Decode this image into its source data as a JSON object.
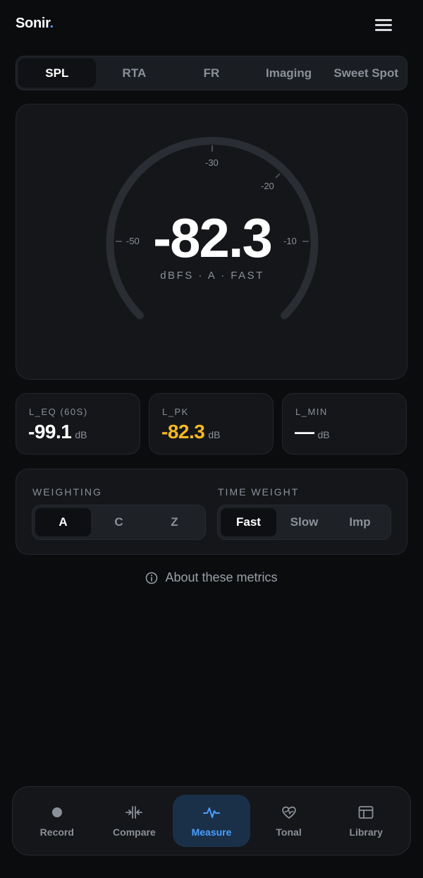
{
  "app": {
    "name": "Sonir",
    "name_dot": "."
  },
  "tabs": [
    {
      "label": "SPL",
      "active": true
    },
    {
      "label": "RTA",
      "active": false
    },
    {
      "label": "FR",
      "active": false
    },
    {
      "label": "Imaging",
      "active": false
    },
    {
      "label": "Sweet Spot",
      "active": false
    }
  ],
  "gauge": {
    "value": "-82.3",
    "unit_line": "dBFS · A · FAST",
    "tick_labels": {
      "t50": "-50",
      "t30": "-30",
      "t20": "-20",
      "t10": "-10"
    }
  },
  "stats": [
    {
      "label": "L_EQ (60S)",
      "value": "-99.1",
      "unit": "dB"
    },
    {
      "label": "L_PK",
      "value": "-82.3",
      "unit": "dB"
    },
    {
      "label": "L_MIN",
      "value": "—",
      "unit": "dB"
    }
  ],
  "controls": {
    "weighting": {
      "label": "WEIGHTING",
      "options": [
        "A",
        "C",
        "Z"
      ],
      "selected": "A"
    },
    "time_weight": {
      "label": "TIME WEIGHT",
      "options": [
        "Fast",
        "Slow",
        "Imp"
      ],
      "selected": "Fast"
    }
  },
  "about_link": "About these metrics",
  "nav": [
    {
      "label": "Record",
      "icon": "record-icon",
      "active": false
    },
    {
      "label": "Compare",
      "icon": "compare-icon",
      "active": false
    },
    {
      "label": "Measure",
      "icon": "pulse-icon",
      "active": true
    },
    {
      "label": "Tonal",
      "icon": "heart-pulse-icon",
      "active": false
    },
    {
      "label": "Library",
      "icon": "library-icon",
      "active": false
    }
  ],
  "colors": {
    "accent": "#4a9eff",
    "peak": "#f5b820",
    "background": "#0b0c0e",
    "card": "#141619"
  }
}
